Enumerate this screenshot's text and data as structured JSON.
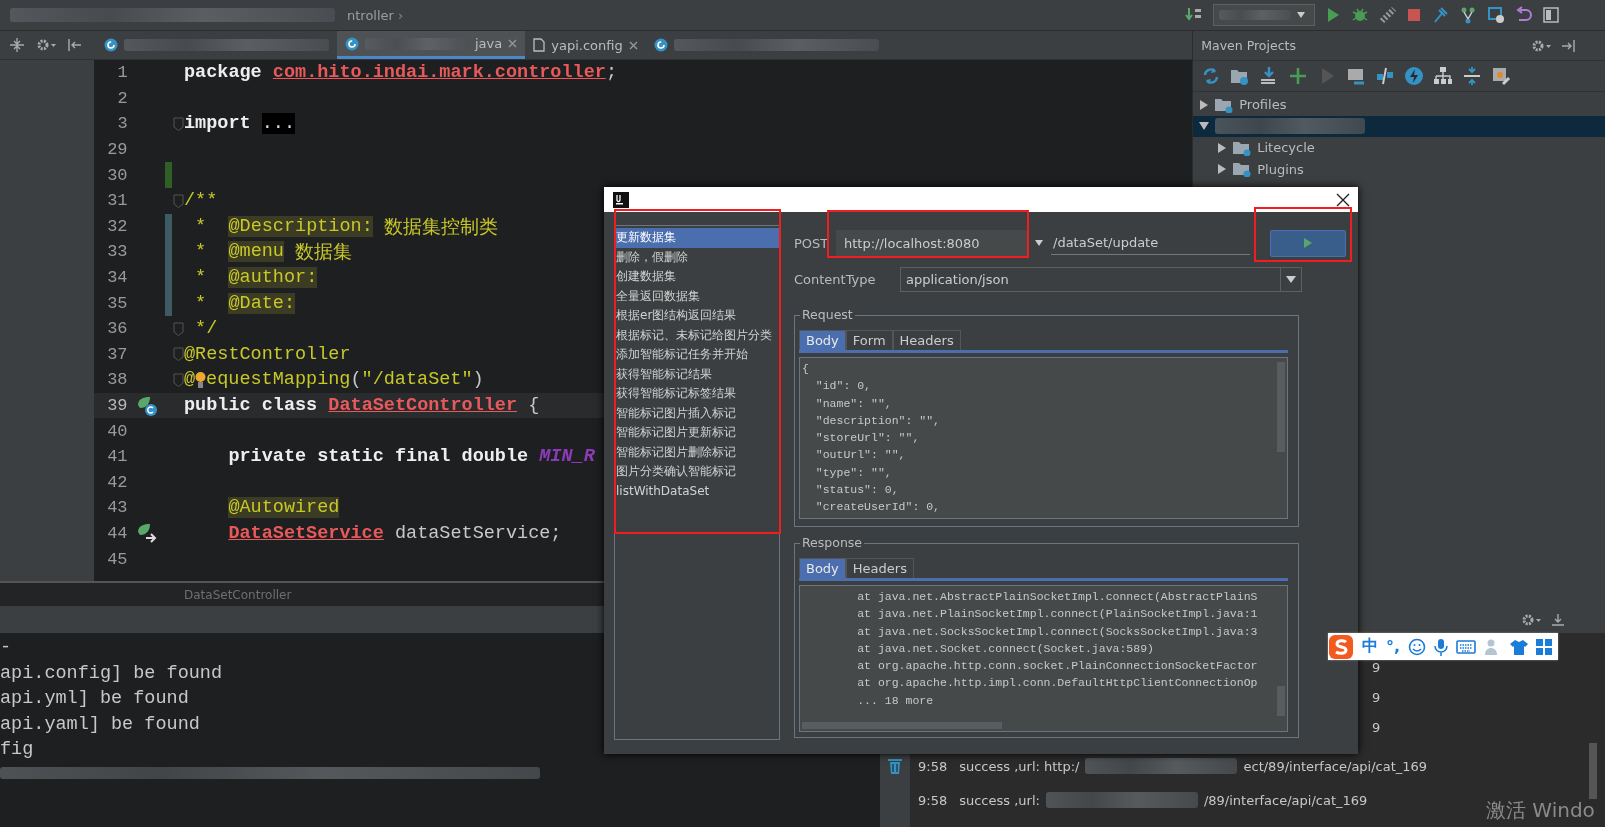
{
  "top_bar": {
    "breadcrumb": "ntroller",
    "separator": "›"
  },
  "editor_tabs": [
    {
      "redacted": true,
      "selected": false,
      "closable": false
    },
    {
      "label": "java",
      "redacted": true,
      "selected": true,
      "closable": true
    },
    {
      "label": "yapi.config",
      "redacted": false,
      "selected": false,
      "closable": true
    },
    {
      "redacted": true,
      "selected": false,
      "closable": false
    }
  ],
  "editor": {
    "lines": [
      {
        "number": "1",
        "current": false,
        "tokens": [
          {
            "kind": "keyword",
            "text": "package "
          },
          {
            "kind": "error",
            "text": "com.hito.indai.mark.controller"
          },
          {
            "kind": "plain",
            "text": ";"
          }
        ]
      },
      {
        "number": "2",
        "current": false
      },
      {
        "number": "3",
        "current": false,
        "fold": true,
        "tokens": [
          {
            "kind": "keyword",
            "text": "import "
          },
          {
            "kind": "folded",
            "text": "..."
          }
        ]
      },
      {
        "number": "29",
        "current": false
      },
      {
        "number": "30",
        "current": false,
        "added": true
      },
      {
        "number": "31",
        "current": false,
        "fold": true,
        "tokens": [
          {
            "kind": "comment",
            "text": "/**"
          }
        ]
      },
      {
        "number": "32",
        "current": false,
        "modified": true,
        "tokens": [
          {
            "kind": "comment",
            "text": " *  "
          },
          {
            "kind": "doc_tag",
            "text": "@Description:"
          },
          {
            "kind": "comment",
            "text": " 数据集控制类"
          }
        ]
      },
      {
        "number": "33",
        "current": false,
        "modified": true,
        "tokens": [
          {
            "kind": "comment",
            "text": " *  "
          },
          {
            "kind": "doc_tag",
            "text": "@menu"
          },
          {
            "kind": "comment",
            "text": " 数据集"
          }
        ]
      },
      {
        "number": "34",
        "current": false,
        "modified": true,
        "tokens": [
          {
            "kind": "comment",
            "text": " *  "
          },
          {
            "kind": "doc_tag",
            "text": "@author:"
          }
        ]
      },
      {
        "number": "35",
        "current": false,
        "modified": true,
        "tokens": [
          {
            "kind": "comment",
            "text": " *  "
          },
          {
            "kind": "doc_tag",
            "text": "@Date:"
          }
        ]
      },
      {
        "number": "36",
        "current": false,
        "fold": true,
        "tokens": [
          {
            "kind": "comment",
            "text": " */"
          }
        ]
      },
      {
        "number": "37",
        "current": false,
        "fold": true,
        "tokens": [
          {
            "kind": "annotation",
            "text": "@RestController"
          }
        ]
      },
      {
        "number": "38",
        "current": false,
        "fold": true,
        "tokens": [
          {
            "kind": "annotation",
            "text": "@"
          },
          {
            "kind": "bulb"
          },
          {
            "kind": "annotation",
            "text": "equestMapping"
          },
          {
            "kind": "plain",
            "text": "("
          },
          {
            "kind": "string",
            "text": "\"/dataSet\""
          },
          {
            "kind": "plain",
            "text": ")"
          }
        ]
      },
      {
        "number": "39",
        "current": true,
        "class_icon": true,
        "tokens": [
          {
            "kind": "keyword",
            "text": "public class "
          },
          {
            "kind": "error",
            "text": "DataSetController"
          },
          {
            "kind": "plain",
            "text": " {"
          }
        ]
      },
      {
        "number": "40",
        "current": false
      },
      {
        "number": "41",
        "current": false,
        "indented": true,
        "tokens": [
          {
            "kind": "keyword",
            "text": "private static final double "
          },
          {
            "kind": "constant",
            "text": "MIN_R"
          }
        ]
      },
      {
        "number": "42",
        "current": false
      },
      {
        "number": "43",
        "current": false,
        "indented": true,
        "tokens": [
          {
            "kind": "doc_tag",
            "text": "@Autowired"
          }
        ]
      },
      {
        "number": "44",
        "current": false,
        "indented": true,
        "bean_icon": true,
        "tokens": [
          {
            "kind": "error",
            "text": "DataSetService"
          },
          {
            "kind": "plain",
            "text": " dataSetService;"
          }
        ]
      },
      {
        "number": "45",
        "current": false
      }
    ],
    "breadcrumb": "DataSetController"
  },
  "maven": {
    "title": "Maven Projects",
    "tree": [
      {
        "label": "Profiles",
        "redacted": false,
        "expanded": false,
        "selected": false
      },
      {
        "redacted": true,
        "expanded": true,
        "selected": true,
        "children": [
          {
            "label": "Litecycle",
            "redacted": false,
            "expanded": false,
            "selected": false
          },
          {
            "label": "Plugins",
            "redacted": false,
            "expanded": false,
            "selected": false
          }
        ]
      }
    ]
  },
  "console": {
    "lines": [
      "-",
      "api.config] be found",
      "api.yml] be found",
      "api.yaml] be found",
      "fig"
    ]
  },
  "event_log": {
    "rows": [
      {
        "kind": "partial",
        "text": "9"
      },
      {
        "kind": "partial",
        "text": "9"
      },
      {
        "kind": "partial",
        "text": "9"
      },
      {
        "kind": "entry",
        "time": "9:58",
        "text": "success ,url:  http:/",
        "tail": "ect/89/interface/api/cat_169"
      },
      {
        "kind": "entry",
        "time": "9:58",
        "text": "success ,url:",
        "tail": "/89/interface/api/cat_169"
      }
    ]
  },
  "dialog": {
    "endpoints": [
      {
        "label": "更新数据集",
        "selected": true
      },
      {
        "label": "删除，假删除",
        "selected": false
      },
      {
        "label": "创建数据集",
        "selected": false
      },
      {
        "label": "全量返回数据集",
        "selected": false
      },
      {
        "label": "根据er图结构返回结果",
        "selected": false
      },
      {
        "label": "根据标记、未标记给图片分类",
        "selected": false
      },
      {
        "label": "添加智能标记任务并开始",
        "selected": false
      },
      {
        "label": "获得智能标记结果",
        "selected": false
      },
      {
        "label": "获得智能标记标签结果",
        "selected": false
      },
      {
        "label": "智能标记图片插入标记",
        "selected": false
      },
      {
        "label": "智能标记图片更新标记",
        "selected": false
      },
      {
        "label": "智能标记图片删除标记",
        "selected": false
      },
      {
        "label": "图片分类确认智能标记",
        "selected": false
      },
      {
        "label": "listWithDataSet",
        "selected": false
      }
    ],
    "method": "POST",
    "host": "http://localhost:8080",
    "path": "/dataSet/update",
    "content_type_label": "ContentType",
    "content_type": "application/json",
    "request": {
      "title": "Request",
      "tabs": [
        {
          "label": "Body",
          "selected": true
        },
        {
          "label": "Form",
          "selected": false
        },
        {
          "label": "Headers",
          "selected": false
        }
      ],
      "lines": [
        "{",
        "  \"id\": 0,",
        "  \"name\": \"\",",
        "  \"description\": \"\",",
        "  \"storeUrl\": \"\",",
        "  \"outUrl\": \"\",",
        "  \"type\": \"\",",
        "  \"status\": 0,",
        "  \"createUserId\": 0,"
      ]
    },
    "response": {
      "title": "Response",
      "tabs": [
        {
          "label": "Body",
          "selected": true
        },
        {
          "label": "Headers",
          "selected": false
        }
      ],
      "lines": [
        "        at java.net.AbstractPlainSocketImpl.connect(AbstractPlainS",
        "        at java.net.PlainSocketImpl.connect(PlainSocketImpl.java:1",
        "        at java.net.SocksSocketImpl.connect(SocksSocketImpl.java:3",
        "        at java.net.Socket.connect(Socket.java:589)",
        "        at org.apache.http.conn.socket.PlainConnectionSocketFactor",
        "        at org.apache.http.impl.conn.DefaultHttpClientConnectionOp",
        "        ... 18 more"
      ]
    }
  },
  "ime": {
    "items": [
      "中",
      "°,"
    ]
  },
  "os_notice": "激活 Windo"
}
